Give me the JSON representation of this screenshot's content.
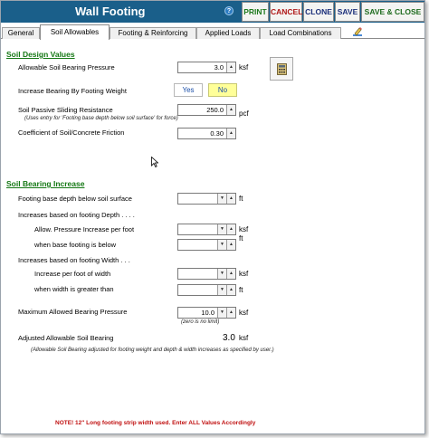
{
  "toolbar": {
    "title": "Wall Footing",
    "help": "?",
    "print": "PRINT",
    "cancel": "CANCEL",
    "clone": "CLONE",
    "save": "SAVE",
    "save_close": "SAVE & CLOSE"
  },
  "tabs": [
    {
      "label": "General"
    },
    {
      "label": "Soil Allowables"
    },
    {
      "label": "Footing & Reinforcing"
    },
    {
      "label": "Applied Loads"
    },
    {
      "label": "Load Combinations"
    }
  ],
  "soil_design": {
    "section_title": "Soil Design Values",
    "allowable_label": "Allowable Soil Bearing Pressure",
    "allowable_value": "3.0",
    "allowable_unit": "ksf",
    "increase_label": "Increase Bearing By Footing Weight",
    "yes": "Yes",
    "no": "No",
    "passive_label": "Soil Passive Sliding Resistance",
    "passive_note": "(Uses entry for 'Footing base depth below soil surface' for force)",
    "passive_value": "250.0",
    "passive_unit": "pcf",
    "friction_label": "Coefficient of Soil/Concrete Friction",
    "friction_value": "0.30"
  },
  "bearing_increase": {
    "section_title": "Soil Bearing Increase",
    "depth_label": "Footing base depth below soil surface",
    "depth_unit": "ft",
    "depth_based_label": "Increases based on footing Depth . . . .",
    "allow_increase_label": "Allow. Pressure Increase per foot",
    "allow_increase_unit": "ksf",
    "below_label": "when base footing is below",
    "below_unit": "ft",
    "width_based_label": "Increases based on footing Width . . .",
    "increase_width_label": "Increase per foot of width",
    "increase_width_unit": "ksf",
    "greater_label": "when width is greater than",
    "greater_unit": "ft",
    "max_label": "Maximum Allowed Bearing Pressure",
    "max_value": "10.0",
    "max_unit": "ksf",
    "max_note": "(zero is no limit)",
    "adjusted_label": "Adjusted Allowable Soil Bearing",
    "adjusted_value": "3.0",
    "adjusted_unit": "ksf",
    "adjusted_note": "(Allowable Soil Bearing adjusted for footing weight and depth & width increases as specified by user.)"
  },
  "footer_note": "NOTE! 12\" Long footing strip width used. Enter ALL Values Accordingly",
  "icons": {
    "calculator": "calculator-icon",
    "edit": "pencil-icon",
    "cursor": "mouse-cursor-icon"
  },
  "colors": {
    "titlebar": "#1a5f8a",
    "section_title": "#147814",
    "no_selected": "#ffff99",
    "footer_note": "#c01010"
  }
}
